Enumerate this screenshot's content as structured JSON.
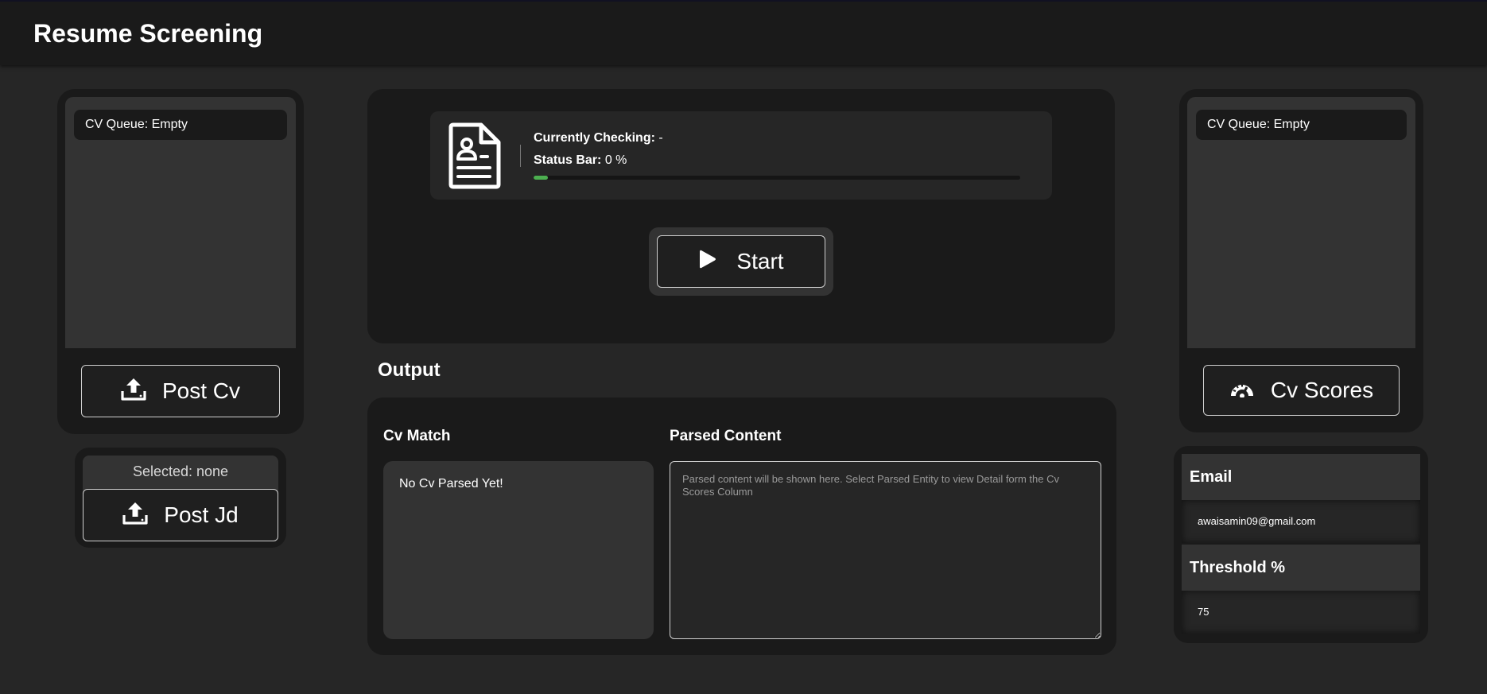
{
  "app": {
    "title": "Resume Screening"
  },
  "left": {
    "queue_label": "CV Queue: Empty",
    "post_cv_label": "Post Cv",
    "selected_label": "Selected: none",
    "post_jd_label": "Post Jd"
  },
  "status": {
    "checking_label": "Currently Checking:",
    "checking_value": "-",
    "status_label": "Status Bar:",
    "status_value": "0 %",
    "progress_fraction": 0.03,
    "progress_color": "#4caf50"
  },
  "controls": {
    "start_label": "Start"
  },
  "output": {
    "title": "Output",
    "cv_match_heading": "Cv Match",
    "cv_match_text": "No Cv Parsed Yet!",
    "parsed_heading": "Parsed Content",
    "parsed_placeholder": "Parsed content will be shown here. Select Parsed Entity to view Detail form the Cv Scores Column"
  },
  "right": {
    "queue_label": "CV Queue: Empty",
    "cv_scores_label": "Cv Scores",
    "email_heading": "Email",
    "email_value": "awaisamin09@gmail.com",
    "threshold_heading": "Threshold %",
    "threshold_value": "75"
  },
  "icons": {
    "upload": "upload-icon",
    "play": "play-icon",
    "gauge": "gauge-icon",
    "document": "resume-document-icon"
  }
}
